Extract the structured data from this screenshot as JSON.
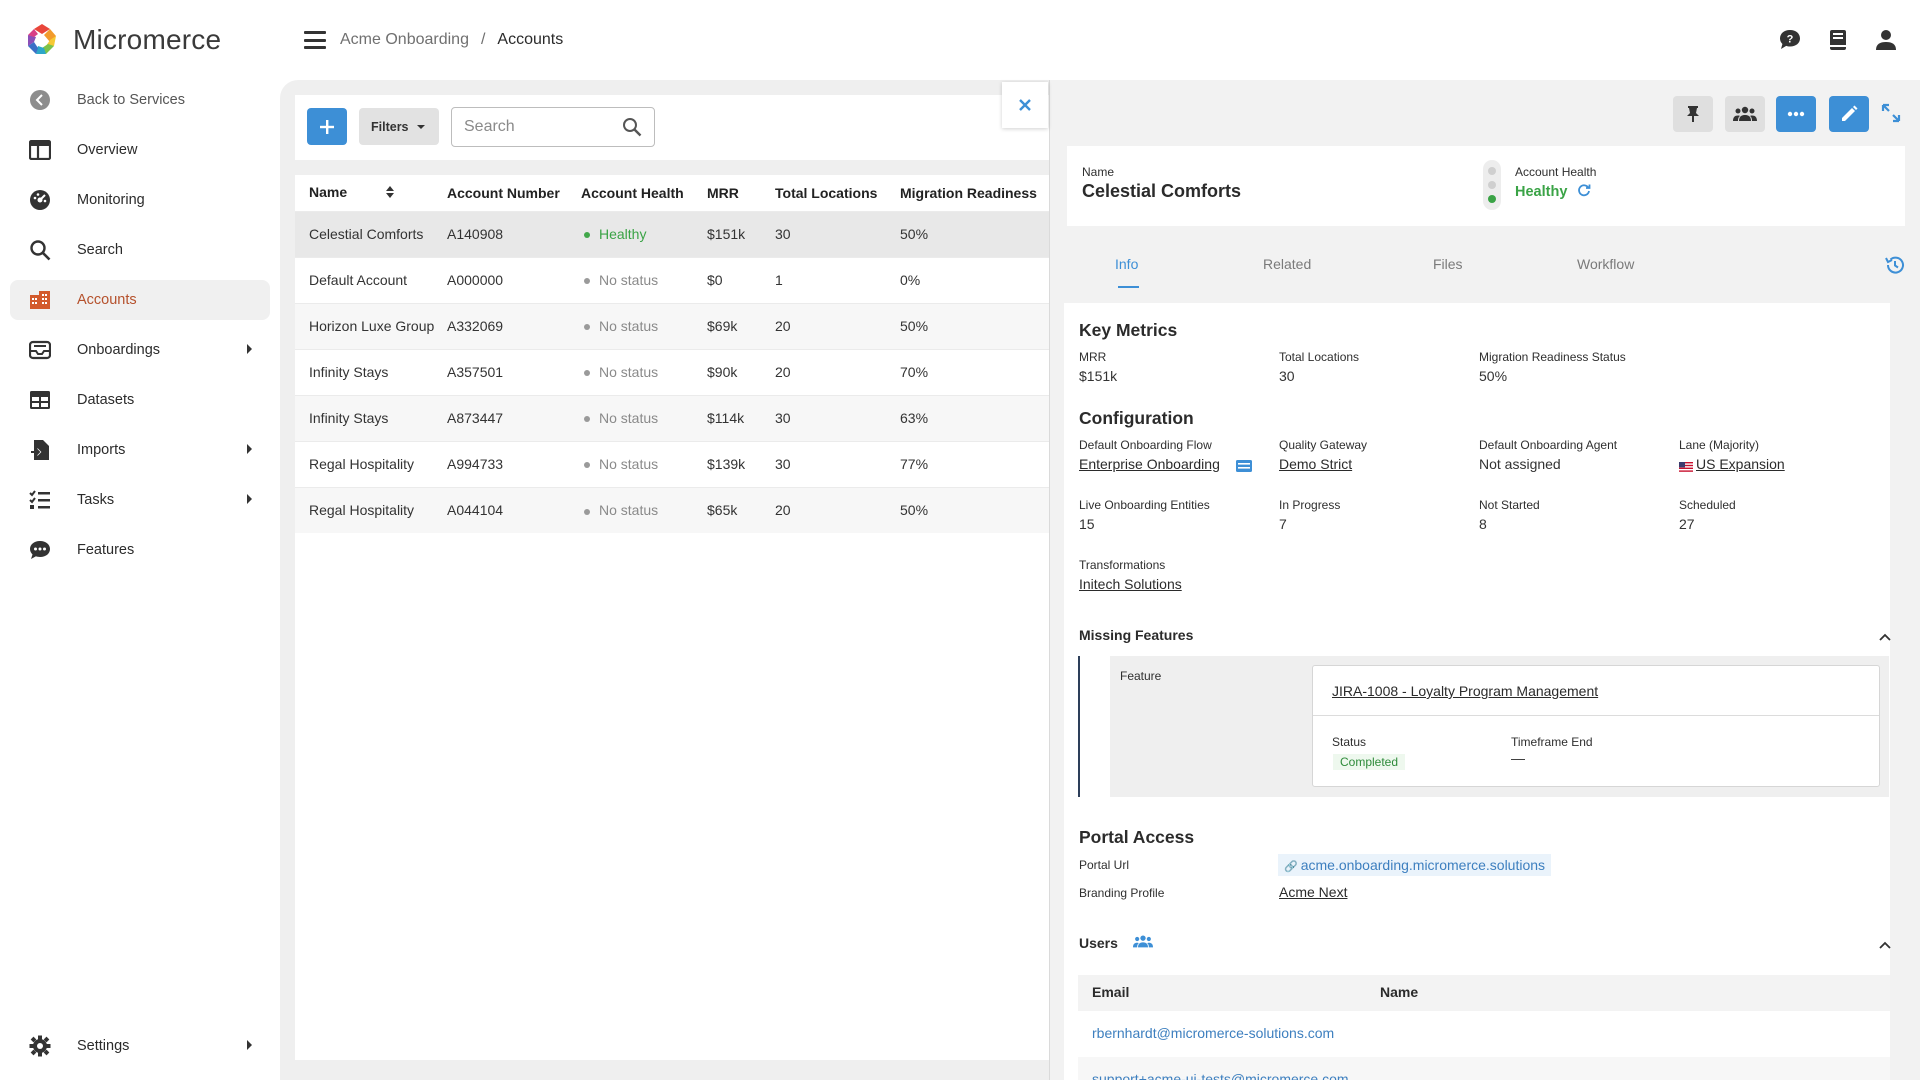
{
  "brand": {
    "name": "Micromerce"
  },
  "sidebar": {
    "back_label": "Back to Services",
    "items": [
      {
        "label": "Overview",
        "icon": "overview-icon"
      },
      {
        "label": "Monitoring",
        "icon": "monitoring-icon"
      },
      {
        "label": "Search",
        "icon": "search-icon"
      },
      {
        "label": "Accounts",
        "icon": "accounts-icon",
        "active": true
      },
      {
        "label": "Onboardings",
        "icon": "onboardings-icon",
        "has_submenu": true
      },
      {
        "label": "Datasets",
        "icon": "datasets-icon"
      },
      {
        "label": "Imports",
        "icon": "imports-icon",
        "has_submenu": true
      },
      {
        "label": "Tasks",
        "icon": "tasks-icon",
        "has_submenu": true
      },
      {
        "label": "Features",
        "icon": "features-icon"
      }
    ],
    "settings_label": "Settings"
  },
  "header": {
    "breadcrumb": {
      "parent": "Acme Onboarding",
      "separator": "/",
      "current": "Accounts"
    },
    "icons": [
      "feedback-icon",
      "docs-icon",
      "account-icon"
    ]
  },
  "toolbar": {
    "filters_label": "Filters",
    "search_placeholder": "Search"
  },
  "table": {
    "columns": [
      "Name",
      "Account Number",
      "Account Health",
      "MRR",
      "Total Locations",
      "Migration Readiness"
    ],
    "rows": [
      {
        "name": "Celestial Comforts",
        "number": "A140908",
        "health": "Healthy",
        "mrr": "$151k",
        "locations": "30",
        "readiness": "50%"
      },
      {
        "name": "Default Account",
        "number": "A000000",
        "health": "No status",
        "mrr": "$0",
        "locations": "1",
        "readiness": "0%"
      },
      {
        "name": "Horizon Luxe Group",
        "number": "A332069",
        "health": "No status",
        "mrr": "$69k",
        "locations": "20",
        "readiness": "50%"
      },
      {
        "name": "Infinity Stays",
        "number": "A357501",
        "health": "No status",
        "mrr": "$90k",
        "locations": "20",
        "readiness": "70%"
      },
      {
        "name": "Infinity Stays",
        "number": "A873447",
        "health": "No status",
        "mrr": "$114k",
        "locations": "30",
        "readiness": "63%"
      },
      {
        "name": "Regal Hospitality",
        "number": "A994733",
        "health": "No status",
        "mrr": "$139k",
        "locations": "30",
        "readiness": "77%"
      },
      {
        "name": "Regal Hospitality",
        "number": "A044104",
        "health": "No status",
        "mrr": "$65k",
        "locations": "20",
        "readiness": "50%"
      }
    ]
  },
  "detail": {
    "name_label": "Name",
    "name_value": "Celestial Comforts",
    "health_label": "Account Health",
    "health_value": "Healthy",
    "tabs": [
      "Info",
      "Related",
      "Files",
      "Workflow"
    ],
    "key_metrics": {
      "title": "Key Metrics",
      "mrr_label": "MRR",
      "mrr_value": "$151k",
      "locations_label": "Total Locations",
      "locations_value": "30",
      "readiness_label": "Migration Readiness Status",
      "readiness_value": "50%"
    },
    "configuration": {
      "title": "Configuration",
      "flow_label": "Default Onboarding Flow",
      "flow_value": "Enterprise Onboarding",
      "gateway_label": "Quality Gateway",
      "gateway_value": "Demo Strict",
      "agent_label": "Default Onboarding Agent",
      "agent_value": "Not assigned",
      "lane_label": "Lane (Majority)",
      "lane_value": "US Expansion",
      "live_label": "Live Onboarding Entities",
      "live_value": "15",
      "progress_label": "In Progress",
      "progress_value": "7",
      "notstarted_label": "Not Started",
      "notstarted_value": "8",
      "scheduled_label": "Scheduled",
      "scheduled_value": "27",
      "transform_label": "Transformations",
      "transform_value": "Initech Solutions"
    },
    "missing_features": {
      "title": "Missing Features",
      "feature_label": "Feature",
      "feature_link": "JIRA-1008 - Loyalty Program Management",
      "status_label": "Status",
      "status_value": "Completed",
      "timeframe_label": "Timeframe End",
      "timeframe_value": "—"
    },
    "portal": {
      "title": "Portal Access",
      "url_label": "Portal Url",
      "url_value": "acme.onboarding.micromerce.solutions",
      "branding_label": "Branding Profile",
      "branding_value": "Acme Next"
    },
    "users": {
      "title": "Users",
      "col_email": "Email",
      "col_name": "Name",
      "rows": [
        {
          "email": "rbernhardt@micromerce-solutions.com",
          "name": ""
        },
        {
          "email": "support+acme-ui-tests@micromerce.com",
          "name": ""
        }
      ]
    }
  },
  "colors": {
    "accent_blue": "#3d8fd6",
    "active_nav": "#b5512c",
    "healthy_green": "#3aa346"
  }
}
